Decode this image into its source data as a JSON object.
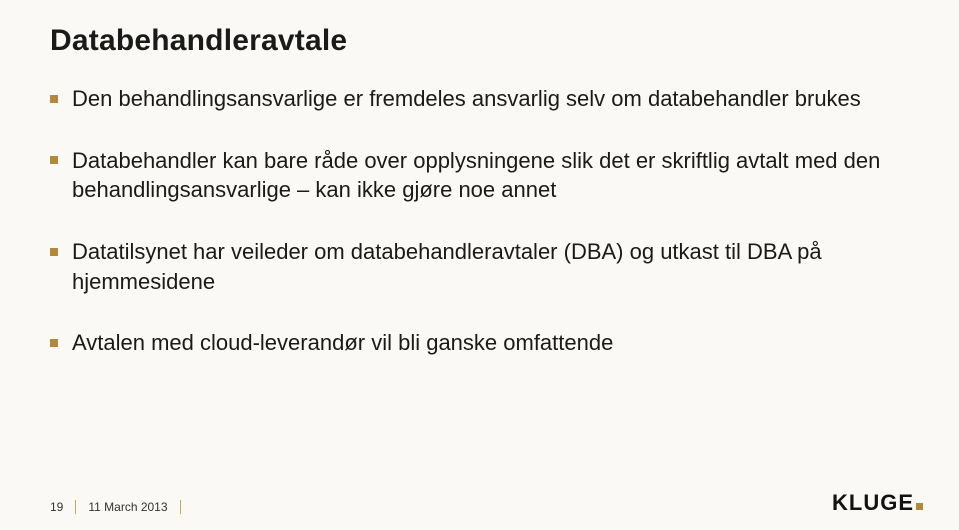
{
  "slide": {
    "title": "Databehandleravtale",
    "bullets": [
      "Den behandlingsansvarlige er fremdeles ansvarlig selv om databehandler brukes",
      "Databehandler kan bare råde over opplysningene slik det er skriftlig avtalt med den behandlingsansvarlige – kan ikke gjøre noe annet",
      "Datatilsynet har veileder om databehandleravtaler (DBA) og utkast til DBA  på hjemmesidene",
      "Avtalen med cloud-leverandør vil bli ganske omfattende"
    ]
  },
  "footer": {
    "page_number": "19",
    "date": "11 March 2013"
  },
  "brand": {
    "name": "KLUGE"
  }
}
